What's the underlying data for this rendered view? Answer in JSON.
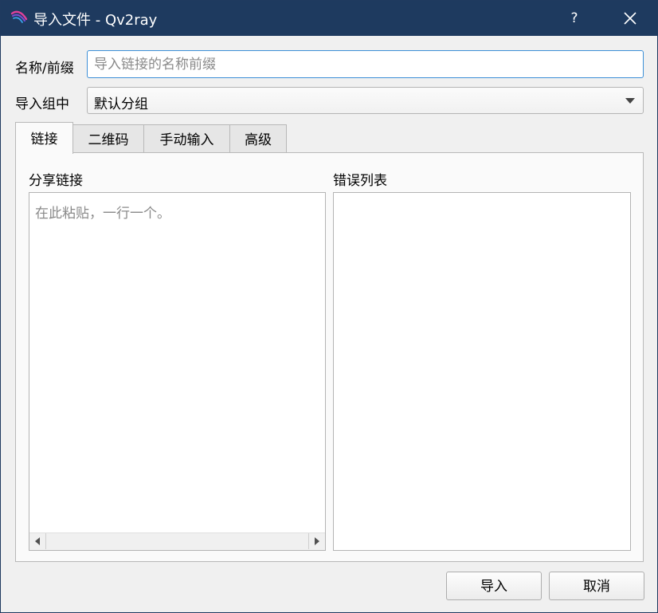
{
  "window": {
    "title": "导入文件 - Qv2ray",
    "help_glyph": "?",
    "title_bar_color": "#1e3a5f"
  },
  "form": {
    "name_label": "名称/前缀",
    "name_placeholder": "导入链接的名称前缀",
    "name_value": "",
    "group_label": "导入组中",
    "group_selected": "默认分组"
  },
  "tabs": [
    {
      "label": "链接",
      "active": true
    },
    {
      "label": "二维码",
      "active": false
    },
    {
      "label": "手动输入",
      "active": false
    },
    {
      "label": "高级",
      "active": false
    }
  ],
  "link_tab": {
    "share_label": "分享链接",
    "share_placeholder": "在此粘贴，一行一个。",
    "error_label": "错误列表"
  },
  "buttons": {
    "import_label": "导入",
    "cancel_label": "取消"
  },
  "icons": {
    "app": "qv2ray-feather-icon",
    "close": "close-icon",
    "dropdown": "chevron-down-icon",
    "scroll_left": "arrow-left-icon",
    "scroll_right": "arrow-right-icon"
  }
}
